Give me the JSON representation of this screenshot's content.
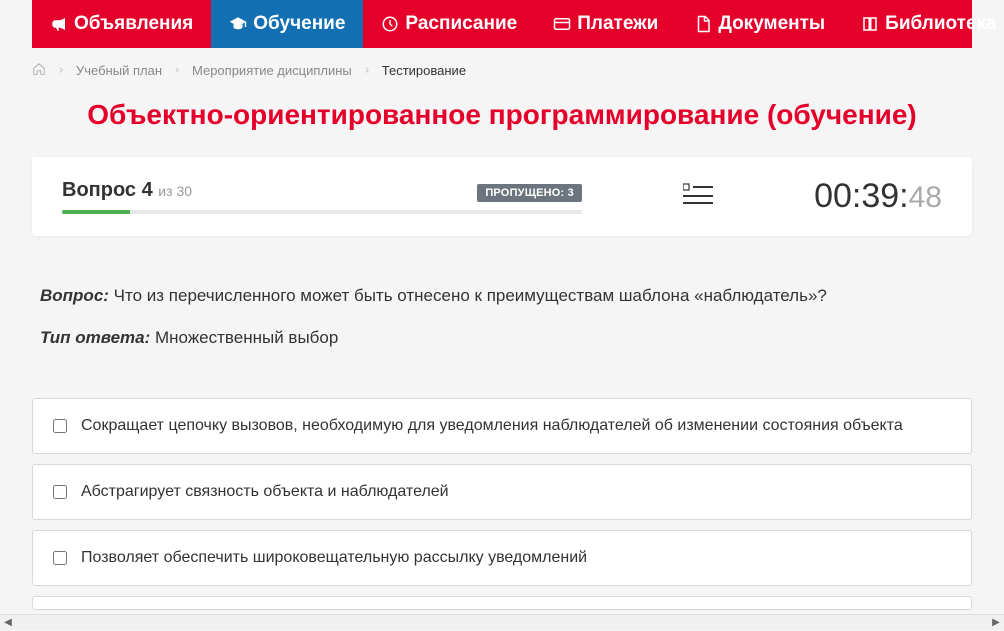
{
  "nav": {
    "items": [
      {
        "label": "Объявления",
        "icon": "megaphone"
      },
      {
        "label": "Обучение",
        "icon": "graduation",
        "active": true
      },
      {
        "label": "Расписание",
        "icon": "clock"
      },
      {
        "label": "Платежи",
        "icon": "card"
      },
      {
        "label": "Документы",
        "icon": "doc"
      },
      {
        "label": "Библиотека",
        "icon": "book",
        "chevron": true
      }
    ]
  },
  "breadcrumb": {
    "items": [
      {
        "label": "Учебный план"
      },
      {
        "label": "Мероприятие дисциплины"
      },
      {
        "label": "Тестирование",
        "current": true
      }
    ]
  },
  "title": "Объектно-ориентированное программирование (обучение)",
  "progress": {
    "question_word": "Вопрос",
    "current": "4",
    "of_word": "из",
    "total": "30",
    "skipped_label": "ПРОПУЩЕНО: 3",
    "percent": 13
  },
  "timer": {
    "mm": "00",
    "ss": "39",
    "cs": "48"
  },
  "question": {
    "label": "Вопрос:",
    "text": "Что из перечисленного может быть отнесено к преимуществам шаблона «наблюдатель»?",
    "answer_type_label": "Тип ответа:",
    "answer_type": "Множественный выбор",
    "options": [
      "Сокращает цепочку вызовов, необходимую для уведомления наблюдателей об изменении состояния объекта",
      "Абстрагирует связность объекта и наблюдателей",
      "Позволяет обеспечить широковещательную рассылку уведомлений"
    ]
  }
}
